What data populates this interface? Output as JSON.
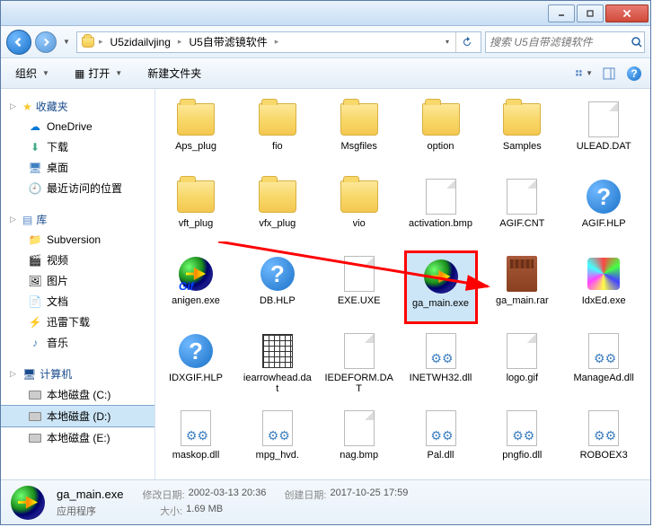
{
  "breadcrumb": {
    "items": [
      "U5zidailvjing",
      "U5自带滤镜软件"
    ]
  },
  "search": {
    "placeholder": "搜索 U5自带滤镜软件"
  },
  "toolbar": {
    "organize": "组织",
    "open": "打开",
    "newfolder": "新建文件夹"
  },
  "sidebar": {
    "favorites": {
      "label": "收藏夹",
      "items": [
        "OneDrive",
        "下载",
        "桌面",
        "最近访问的位置"
      ]
    },
    "libraries": {
      "label": "库",
      "items": [
        "Subversion",
        "视频",
        "图片",
        "文档",
        "迅雷下载",
        "音乐"
      ]
    },
    "computer": {
      "label": "计算机",
      "items": [
        "本地磁盘 (C:)",
        "本地磁盘 (D:)",
        "本地磁盘 (E:)"
      ]
    }
  },
  "files": [
    {
      "name": "Aps_plug",
      "type": "folder"
    },
    {
      "name": "fio",
      "type": "folder"
    },
    {
      "name": "Msgfiles",
      "type": "folder"
    },
    {
      "name": "option",
      "type": "folder"
    },
    {
      "name": "Samples",
      "type": "folder"
    },
    {
      "name": "ULEAD.DAT",
      "type": "file"
    },
    {
      "name": "vft_plug",
      "type": "folder"
    },
    {
      "name": "vfx_plug",
      "type": "folder"
    },
    {
      "name": "vio",
      "type": "folder"
    },
    {
      "name": "activation.bmp",
      "type": "file"
    },
    {
      "name": "AGIF.CNT",
      "type": "file"
    },
    {
      "name": "AGIF.HLP",
      "type": "help"
    },
    {
      "name": "anigen.exe",
      "type": "exe-gif"
    },
    {
      "name": "DB.HLP",
      "type": "help"
    },
    {
      "name": "EXE.UXE",
      "type": "file"
    },
    {
      "name": "ga_main.exe",
      "type": "exe",
      "selected": true,
      "redbox": true
    },
    {
      "name": "ga_main.rar",
      "type": "rar"
    },
    {
      "name": "IdxEd.exe",
      "type": "colorful"
    },
    {
      "name": "IDXGIF.HLP",
      "type": "help"
    },
    {
      "name": "iearrowhead.dat",
      "type": "grid"
    },
    {
      "name": "IEDEFORM.DAT",
      "type": "file"
    },
    {
      "name": "INETWH32.dll",
      "type": "dll"
    },
    {
      "name": "logo.gif",
      "type": "file"
    },
    {
      "name": "ManageAd.dll",
      "type": "dll"
    },
    {
      "name": "maskop.dll",
      "type": "dll"
    },
    {
      "name": "mpg_hvd.",
      "type": "dll"
    },
    {
      "name": "nag.bmp",
      "type": "file"
    },
    {
      "name": "Pal.dll",
      "type": "dll"
    },
    {
      "name": "pngfio.dll",
      "type": "dll"
    },
    {
      "name": "ROBOEX3",
      "type": "dll"
    }
  ],
  "details": {
    "filename": "ga_main.exe",
    "type": "应用程序",
    "mod_label": "修改日期:",
    "mod_value": "2002-03-13 20:36",
    "size_label": "大小:",
    "size_value": "1.69 MB",
    "create_label": "创建日期:",
    "create_value": "2017-10-25 17:59"
  }
}
